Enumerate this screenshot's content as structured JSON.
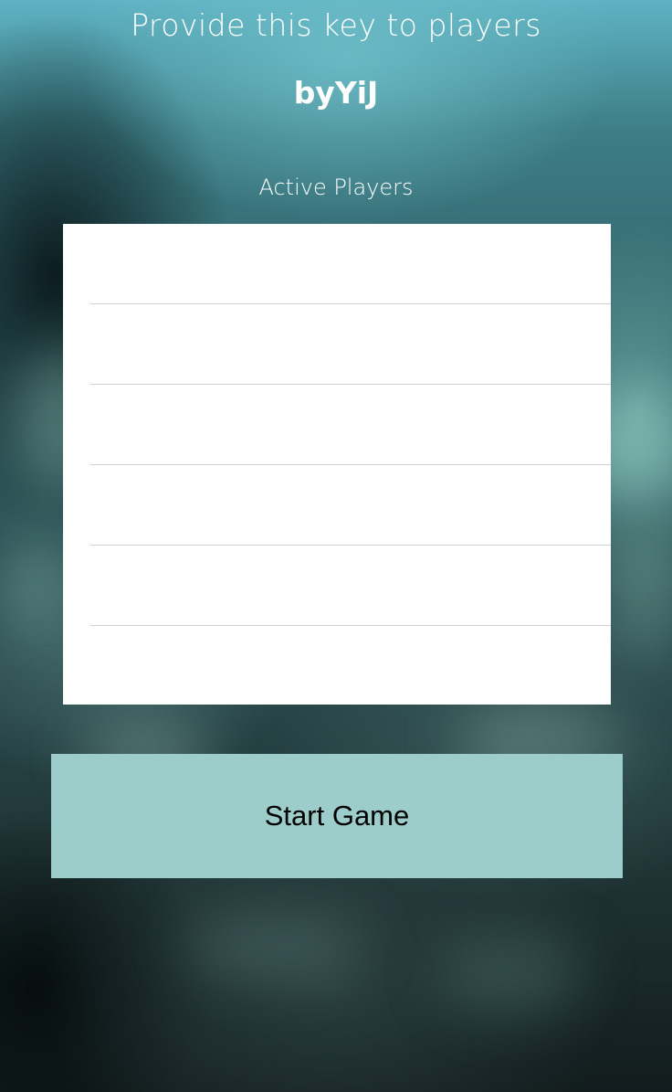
{
  "header": {
    "instruction": "Provide this key to players",
    "game_key": "byYiJ"
  },
  "players": {
    "label": "Active Players",
    "rows": [
      "",
      "",
      "",
      "",
      "",
      ""
    ]
  },
  "actions": {
    "start_label": "Start Game"
  },
  "colors": {
    "button_background": "#9ccdca",
    "list_background": "#ffffff",
    "text": "#ffffff"
  }
}
